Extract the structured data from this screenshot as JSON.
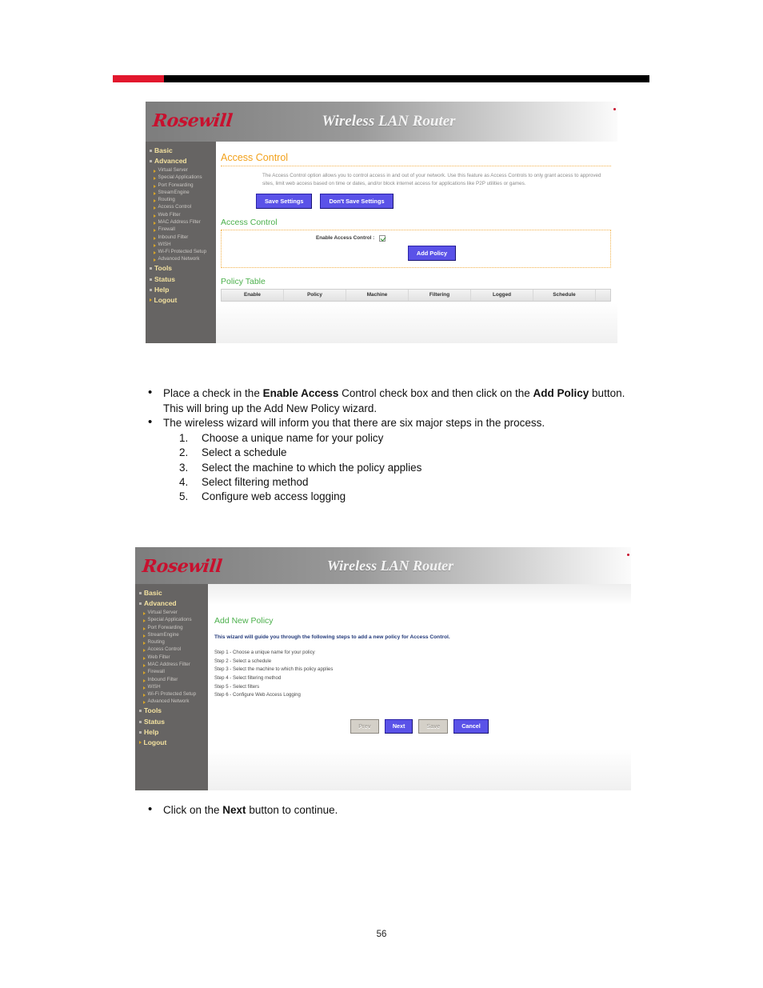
{
  "page": {
    "number": "56",
    "accent_red": "#e2172d",
    "accent_black": "#000000"
  },
  "router_ui": {
    "brand": "Rosewill",
    "title": "Wireless LAN Router",
    "sidebar": {
      "main_items": [
        {
          "label": "Basic"
        },
        {
          "label": "Advanced"
        },
        {
          "label": "Tools"
        },
        {
          "label": "Status"
        },
        {
          "label": "Help"
        },
        {
          "label": "Logout"
        }
      ],
      "sub_items": [
        {
          "label": "Virtual Server"
        },
        {
          "label": "Special Applications"
        },
        {
          "label": "Port Forwarding"
        },
        {
          "label": "StreamEngine"
        },
        {
          "label": "Routing"
        },
        {
          "label": "Access Control"
        },
        {
          "label": "Web Filter"
        },
        {
          "label": "MAC Address Filter"
        },
        {
          "label": "Firewall"
        },
        {
          "label": "Inbound Filter"
        },
        {
          "label": "WISH"
        },
        {
          "label": "Wi-Fi Protected Setup"
        },
        {
          "label": "Advanced Network"
        }
      ]
    }
  },
  "screen1": {
    "section_heading": "Access Control",
    "description": "The Access Control option allows you to control access in and out of your network. Use this feature as Access Controls to only grant access to approved sites, limit web access based on time or dates, and/or block internet access for applications like P2P utilities or games.",
    "save_label": "Save Settings",
    "dont_save_label": "Don't Save Settings",
    "subsection_heading": "Access Control",
    "enable_label": "Enable Access Control :",
    "enable_checked": true,
    "add_policy_label": "Add Policy",
    "policy_table_heading": "Policy Table",
    "policy_table_columns": [
      "Enable",
      "Policy",
      "Machine",
      "Filtering",
      "Logged",
      "Schedule"
    ]
  },
  "screen2": {
    "wizard_title": "Add New Policy",
    "wizard_lead": "This wizard will guide you through the following steps to add a new policy for Access Control.",
    "steps": [
      "Step 1 - Choose a unique name for your policy",
      "Step 2 - Select a schedule",
      "Step 3 - Select the machine to which this policy applies",
      "Step 4 - Select filtering method",
      "Step 5 - Select filters",
      "Step 6 - Configure Web Access Logging"
    ],
    "buttons": [
      {
        "label": "Prev",
        "enabled": false
      },
      {
        "label": "Next",
        "enabled": true
      },
      {
        "label": "Save",
        "enabled": false
      },
      {
        "label": "Cancel",
        "enabled": true
      }
    ]
  },
  "instructions_1": {
    "bullet_1": {
      "part_a": "Place a check in the ",
      "bold_a": "Enable Access",
      "part_b": " Control check box and then click on the ",
      "bold_b": "Add Policy",
      "part_c": " button. This will bring up the Add New Policy wizard."
    },
    "bullet_2": "The wireless wizard will inform you that there are six major steps in the process.",
    "numbered": [
      "Choose a unique name for your policy",
      "Select a schedule",
      "Select the machine to which the policy applies",
      "Select filtering method",
      "Configure web access logging"
    ]
  },
  "instructions_2": {
    "bullet_1": {
      "part_a": "Click on the ",
      "bold_a": "Next",
      "part_b": " button to continue."
    }
  }
}
